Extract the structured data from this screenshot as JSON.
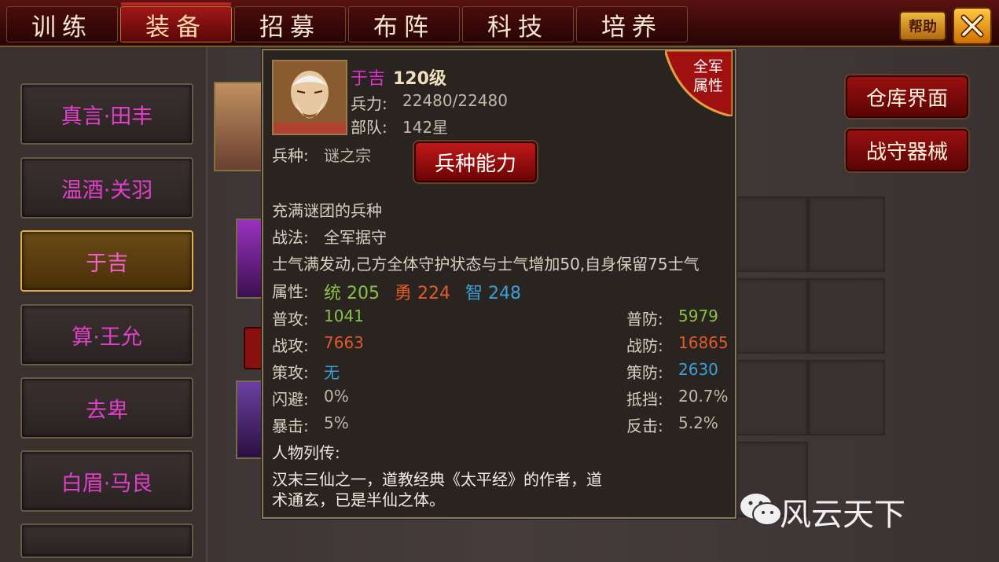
{
  "tabs": [
    "训练",
    "装备",
    "招募",
    "布阵",
    "科技",
    "培养"
  ],
  "active_tab": 1,
  "top_buttons": {
    "help": "帮助"
  },
  "heroes": [
    "真言·田丰",
    "温酒·关羽",
    "于吉",
    "算·王允",
    "去卑",
    "白眉·马良"
  ],
  "selected_hero": 2,
  "right_buttons": {
    "warehouse": "仓库界面",
    "siege": "战守器械"
  },
  "popup": {
    "name": "于吉",
    "level": "120级",
    "troops_label": "兵力:",
    "troops_value": "22480/22480",
    "unit_label": "部队:",
    "unit_value": "142星",
    "army_badge": [
      "全军",
      "属性"
    ],
    "type_label": "兵种:",
    "type_value": "谜之宗",
    "ability_button": "兵种能力",
    "type_desc": "充满谜团的兵种",
    "tactic_label": "战法:",
    "tactic_value": "全军据守",
    "tactic_desc": "士气满发动,己方全体守护状态与士气增加50,自身保留75士气",
    "attr_label": "属性:",
    "attr_tong": "统 205",
    "attr_yong": "勇 224",
    "attr_zhi": "智 248",
    "stats_left": [
      {
        "label": "普攻:",
        "value": "1041",
        "color": "green"
      },
      {
        "label": "战攻:",
        "value": "7663",
        "color": "red"
      },
      {
        "label": "策攻:",
        "value": "无",
        "color": "blue"
      },
      {
        "label": "闪避:",
        "value": "0%",
        "color": "plain"
      },
      {
        "label": "暴击:",
        "value": "5%",
        "color": "plain"
      }
    ],
    "stats_right": [
      {
        "label": "普防:",
        "value": "5979",
        "color": "green"
      },
      {
        "label": "战防:",
        "value": "16865",
        "color": "red"
      },
      {
        "label": "策防:",
        "value": "2630",
        "color": "blue"
      },
      {
        "label": "抵挡:",
        "value": "20.7%",
        "color": "plain"
      },
      {
        "label": "反击:",
        "value": "5.2%",
        "color": "plain"
      }
    ],
    "bio_label": "人物列传:",
    "bio_line1": "汉末三仙之一，道教经典《太平经》的作者，道",
    "bio_line2": "术通玄，已是半仙之体。"
  },
  "watermark": "风云天下",
  "colors": {
    "accent_red": "#c01818",
    "gold": "#e0b040",
    "name_magenta": "#e030d0"
  },
  "icons": [
    "close-icon",
    "wechat-icon"
  ]
}
